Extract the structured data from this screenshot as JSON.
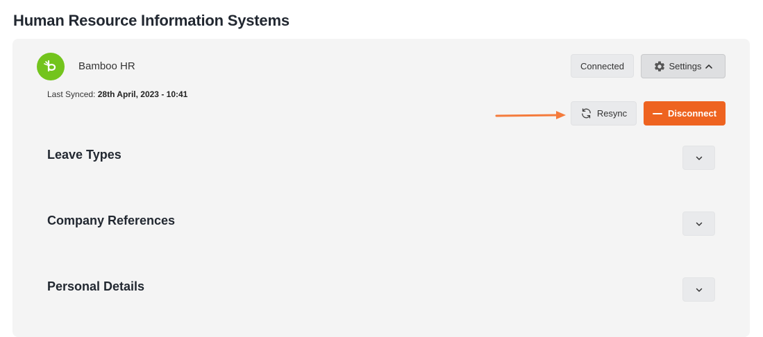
{
  "page": {
    "title": "Human Resource Information Systems"
  },
  "integration": {
    "name": "Bamboo HR",
    "logo_color": "#73c41d",
    "last_synced_label": "Last Synced:",
    "last_synced_value": "28th April, 2023 - 10:41",
    "status": "Connected",
    "settings_label": "Settings",
    "resync_label": "Resync",
    "disconnect_label": "Disconnect"
  },
  "sections": [
    {
      "label": "Leave Types"
    },
    {
      "label": "Company References"
    },
    {
      "label": "Personal Details"
    }
  ],
  "colors": {
    "accent": "#ee6320",
    "arrow": "#f47b3c",
    "card_bg": "#f4f4f4"
  }
}
